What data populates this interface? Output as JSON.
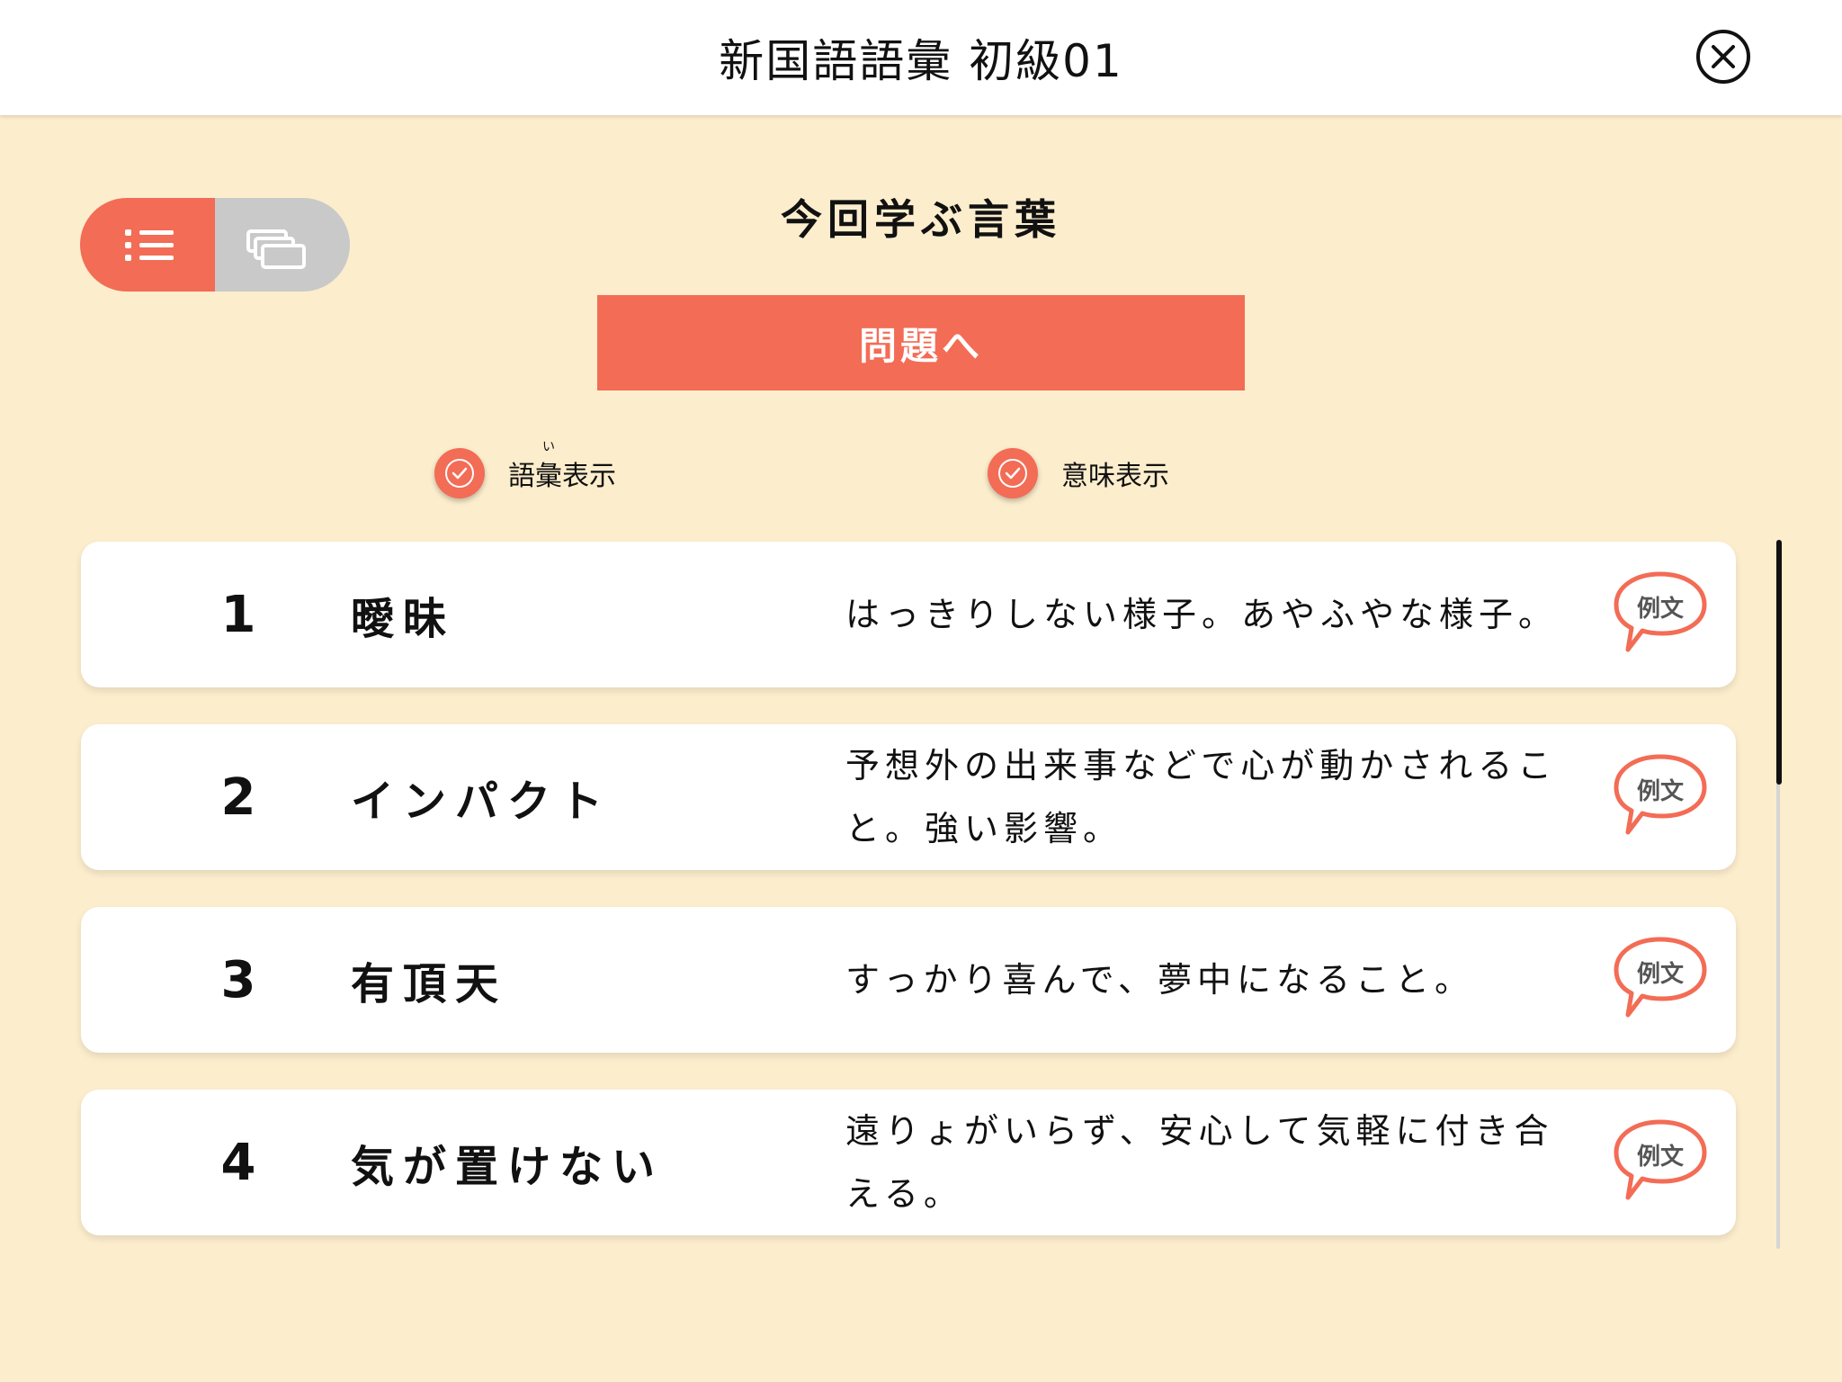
{
  "header": {
    "title": "新国語語彙 初級01",
    "close_icon": "close-icon"
  },
  "view_toggle": {
    "active": "list",
    "list_icon": "list-icon",
    "card_icon": "cards-icon"
  },
  "section_title": "今回学ぶ言葉",
  "quiz_button_label": "問題へ",
  "options": [
    {
      "label": "語彙表示",
      "ruby": "い",
      "checked": true
    },
    {
      "label": "意味表示",
      "checked": true
    }
  ],
  "items": [
    {
      "number": "1",
      "word": "曖昧",
      "meaning": "はっきりしない様子。あやふやな様子。",
      "example_label": "例文"
    },
    {
      "number": "2",
      "word": "インパクト",
      "meaning": "予想外の出来事などで心が動かされること。強い影響。",
      "example_label": "例文"
    },
    {
      "number": "3",
      "word": "有頂天",
      "meaning": "すっかり喜んで、夢中になること。",
      "example_label": "例文"
    },
    {
      "number": "4",
      "word": "気が置けない",
      "meaning": "遠りょがいらず、安心して気軽に付き合える。",
      "example_label": "例文"
    }
  ],
  "colors": {
    "accent": "#F36C55",
    "background": "#FCEDCD",
    "toggle_inactive": "#C9C9C9"
  }
}
